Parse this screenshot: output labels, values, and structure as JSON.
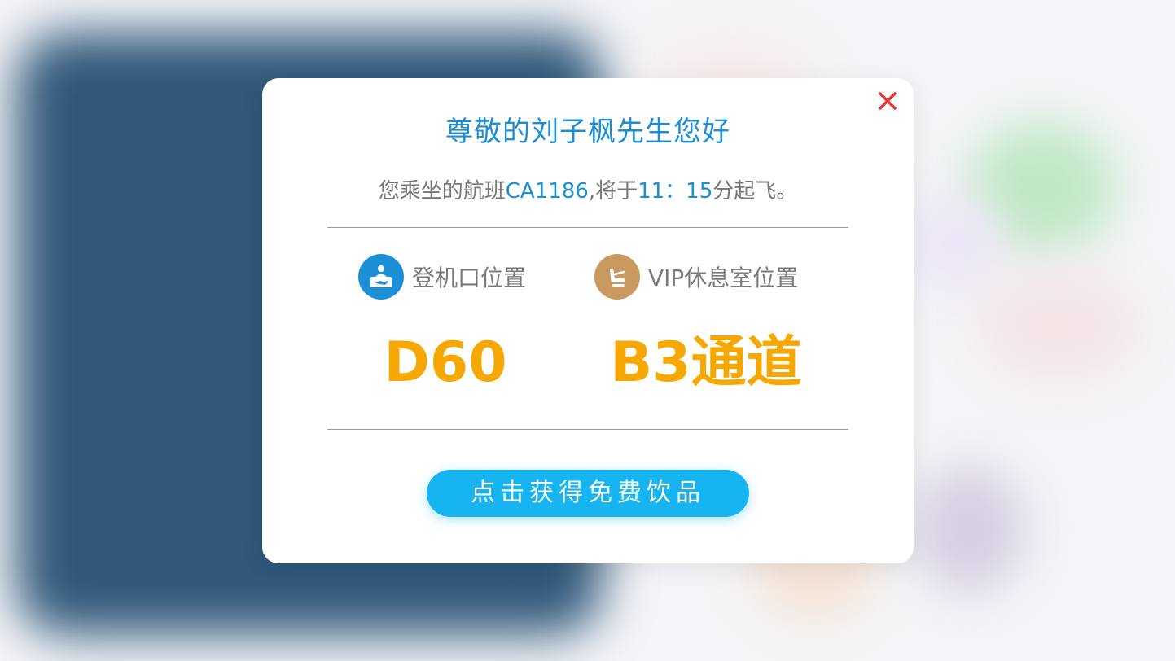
{
  "colors": {
    "accent_blue": "#1a8fd8",
    "highlight_orange": "#f6a800",
    "button_blue": "#16b4f0",
    "close_red": "#e8362f",
    "lounge_icon_tan": "#c9995f"
  },
  "modal": {
    "greeting": "尊敬的刘子枫先生您好",
    "flight": {
      "prefix": "您乘坐的航班",
      "flight_no": "CA1186",
      "middle": ",将于",
      "time": "11：15",
      "suffix": "分起飞。"
    },
    "gate": {
      "icon": "boarding-gate-icon",
      "label": "登机口位置",
      "value": "D60"
    },
    "lounge": {
      "icon": "vip-seat-icon",
      "label": "VIP休息室位置",
      "value": "B3通道"
    },
    "cta_label": "点击获得免费饮品",
    "close_icon": "close-icon"
  }
}
